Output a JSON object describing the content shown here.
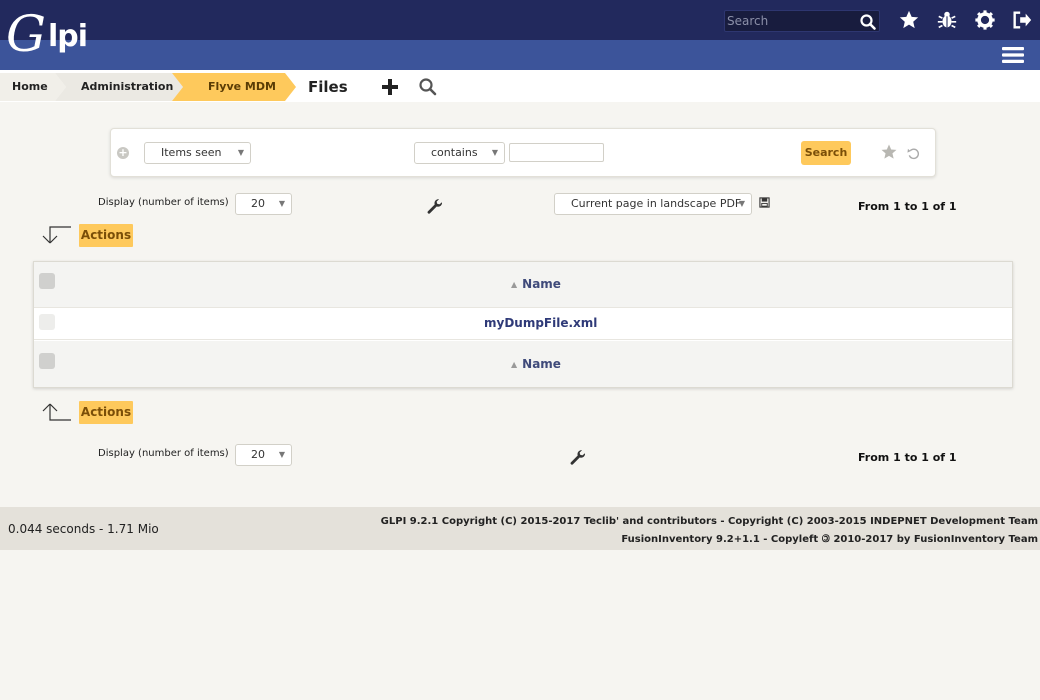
{
  "header": {
    "logo_text": "Glpi",
    "search_placeholder": "Search",
    "icons": [
      "search-icon",
      "star-icon",
      "bug-icon",
      "gear-icon",
      "logout-icon",
      "menu-icon"
    ]
  },
  "breadcrumb": {
    "home": "Home",
    "administration": "Administration",
    "plugin": "Flyve MDM",
    "current": "Files"
  },
  "criteria": {
    "field": "Items seen",
    "operator": "contains",
    "value": "",
    "search_button": "Search"
  },
  "display": {
    "label": "Display (number of items)",
    "per_page": "20",
    "export_option": "Current page in landscape PDF",
    "pager": "From 1 to 1 of 1"
  },
  "actions": {
    "label": "Actions"
  },
  "table": {
    "column_header": "Name",
    "rows": [
      {
        "name": "myDumpFile.xml"
      }
    ]
  },
  "footer": {
    "perf": "0.044 seconds - 1.71 Mio",
    "copyright_line1": "GLPI 9.2.1 Copyright (C) 2015-2017 Teclib' and contributors - Copyright (C) 2003-2015 INDEPNET Development Team",
    "copyright_line2_a": "FusionInventory 9.2+1.1 - Copyleft",
    "copyright_line2_b": "2010-2017 by FusionInventory Team"
  },
  "colors": {
    "topbar": "#22295d",
    "subbar": "#3c549a",
    "accent": "#fec95c",
    "link": "#2f3a78"
  }
}
